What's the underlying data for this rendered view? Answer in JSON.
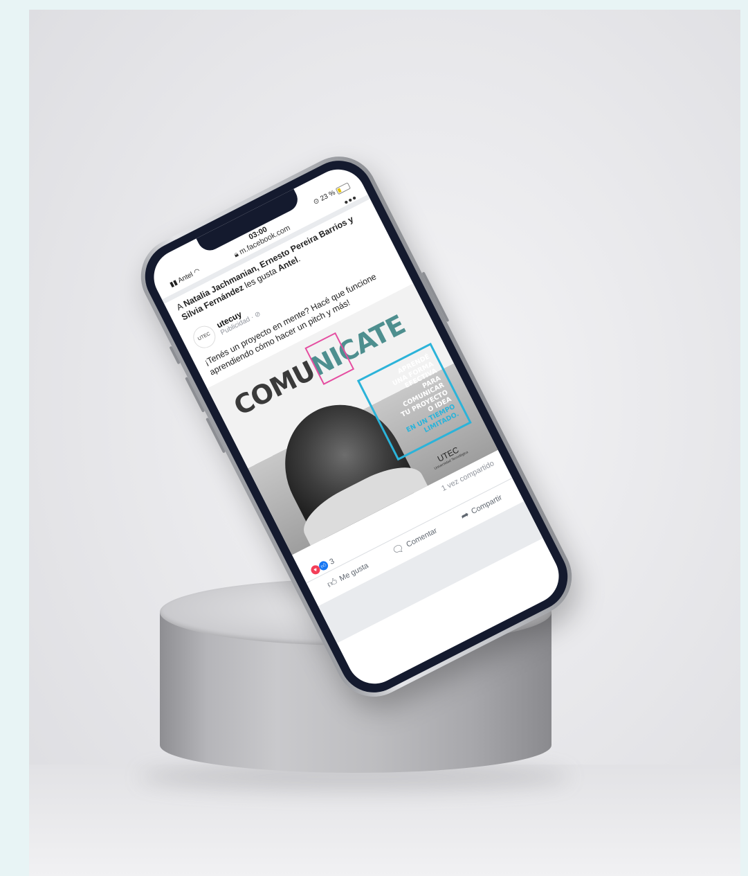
{
  "status_bar": {
    "carrier": "Antel",
    "time": "03:00",
    "url": "m.facebook.com",
    "battery": "23 %"
  },
  "post": {
    "social_context_names": "Natalia Jachmanian, Ernesto Pereira Barrios y Silvia Fernández",
    "social_context_prefix": "A ",
    "social_context_suffix": " les gusta ",
    "social_context_page": "Antel",
    "author": "utecuy",
    "author_sub": "Publicidad · ⊘",
    "avatar_text": "UTEC",
    "text": "¡Tenés un proyecto en mente? Hacé que funcione aprendiendo cómo hacer un pitch y más!",
    "shares": "1 vez compartido",
    "reaction_count": "3",
    "actions": {
      "like": "Me gusta",
      "comment": "Comentar",
      "share": "Compartir"
    }
  },
  "ad": {
    "title_a": "COMU",
    "title_b": "NICATE",
    "box_lines": [
      "APRENDÉ",
      "UNA FORMA",
      "EFECTIVA",
      "PARA",
      "COMUNICAR",
      "TU PROYECTO",
      "O IDEA"
    ],
    "box_emphasis": [
      "EN UN TIEMPO",
      "LIMITADO."
    ],
    "logo": "UTEC",
    "logo_sub": "Universidad Tecnológica"
  },
  "colors": {
    "ad_accent_cyan": "#2bb3d9",
    "ad_frame_pink": "#e54da0",
    "like_blue": "#1877f2",
    "heart_red": "#f33e58"
  }
}
